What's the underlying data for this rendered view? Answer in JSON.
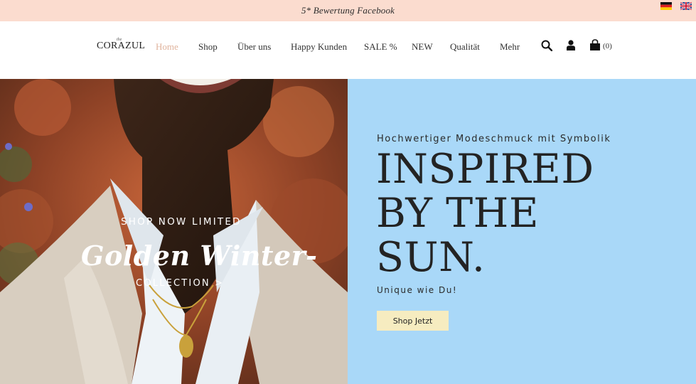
{
  "promo": {
    "text": "5* Bewertung Facebook"
  },
  "languages": [
    "de-flag-icon",
    "uk-flag-icon"
  ],
  "brand": {
    "logo": "CORAZUL",
    "logo_mark": "the"
  },
  "nav": {
    "items": [
      {
        "label": "Home",
        "active": true
      },
      {
        "label": "Shop"
      },
      {
        "label": "Über uns"
      },
      {
        "label": "Happy Kunden"
      },
      {
        "label": "SALE %"
      },
      {
        "label": "NEW"
      },
      {
        "label": "Qualität"
      },
      {
        "label": "Mehr"
      }
    ],
    "accent_color": "#e0b39c"
  },
  "header_icons": [
    "search-icon",
    "account-icon",
    "cart-icon"
  ],
  "cart": {
    "count_label": "(0)"
  },
  "hero": {
    "overlay_small": "SHOP NOW LIMITED",
    "overlay_script": "Golden Winter-",
    "overlay_link": "COLLECTION >",
    "tagline": "Hochwertiger Modeschmuck mit Symbolik",
    "headline_lines": [
      "INSPIRED",
      "BY THE",
      "SUN."
    ],
    "subline": "Unique wie Du!",
    "cta": "Shop Jetzt",
    "panel_color": "#a9d8f8",
    "button_color": "#f6ecc0"
  }
}
